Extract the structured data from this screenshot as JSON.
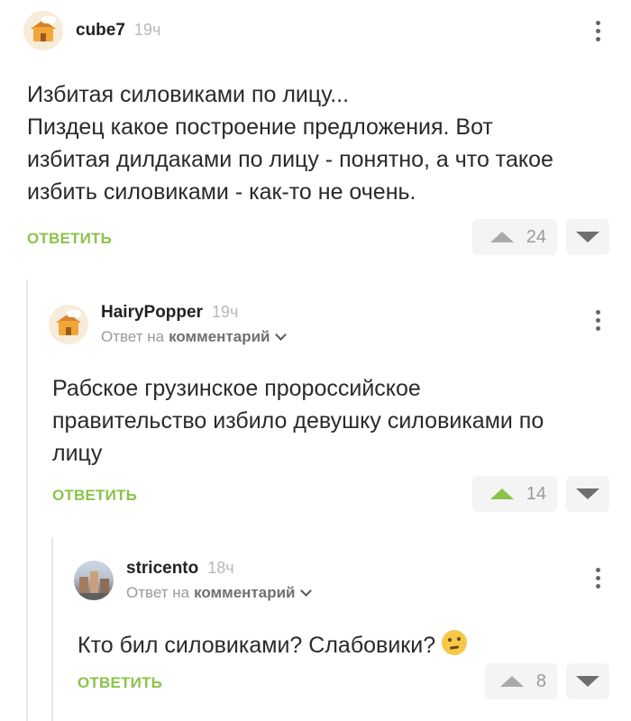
{
  "comments": [
    {
      "username": "cube7",
      "time": "19ч",
      "text_lines": [
        "Избитая силовиками по лицу...",
        "Пиздец какое построение предложения. Вот",
        "избитая дилдаками по лицу - понятно, а что такое",
        "избить силовиками - как-то не очень."
      ],
      "reply_label": "ОТВЕТИТЬ",
      "votes": "24",
      "upvoted": false
    },
    {
      "username": "HairyPopper",
      "time": "19ч",
      "reply_to_prefix": "Ответ на",
      "reply_to_target": "комментарий",
      "text_lines": [
        "Рабское грузинское пророссийское",
        "правительство избило девушку силовиками по",
        "лицу"
      ],
      "reply_label": "ОТВЕТИТЬ",
      "votes": "14",
      "upvoted": true
    },
    {
      "username": "stricento",
      "time": "18ч",
      "reply_to_prefix": "Ответ на",
      "reply_to_target": "комментарий",
      "text": "Кто бил силовиками? Слабовики?",
      "emoji": "thinking-face",
      "reply_label": "ОТВЕТИТЬ",
      "votes": "8",
      "upvoted": false
    }
  ],
  "colors": {
    "accent_green": "#8bc34a",
    "vote_bg": "#f4f4f4",
    "thread_line": "#e7e7e7"
  }
}
